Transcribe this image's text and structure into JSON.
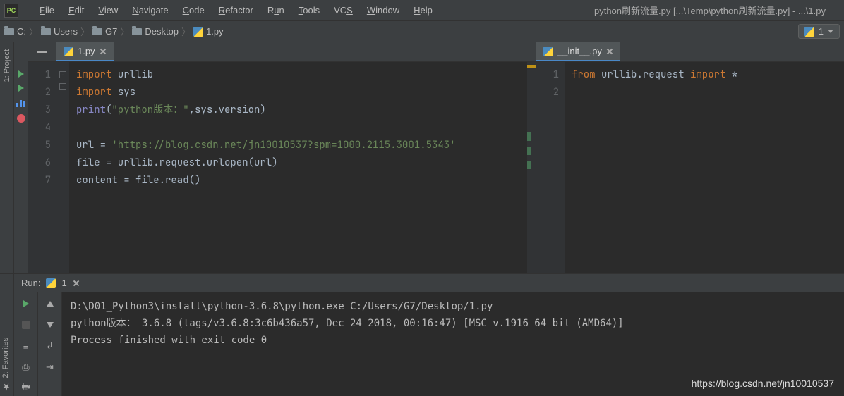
{
  "menubar": {
    "items": [
      "File",
      "Edit",
      "View",
      "Navigate",
      "Code",
      "Refactor",
      "Run",
      "Tools",
      "VCS",
      "Window",
      "Help"
    ],
    "window_title": "python刷新流量.py [...\\Temp\\python刷新流量.py] - ...\\1.py"
  },
  "breadcrumb": {
    "drive": "C:",
    "parts": [
      "Users",
      "G7",
      "Desktop"
    ],
    "file": "1.py"
  },
  "run_config": {
    "label": "1"
  },
  "sidebar": {
    "project_label": "1: Project",
    "favorites_label": "2: Favorites"
  },
  "tabs": {
    "left": {
      "label": "1.py"
    },
    "right": {
      "label": "__init__.py"
    }
  },
  "editor_left": {
    "line_numbers": [
      "1",
      "2",
      "3",
      "4",
      "5",
      "6",
      "7"
    ],
    "lines": [
      {
        "t": "import",
        "i": "urllib"
      },
      {
        "t": "import",
        "i": "sys"
      },
      {
        "t": "print_version",
        "pre": "print(",
        "str": "\"python版本：\"",
        "mid": ",",
        "expr": "sys.version",
        "post": ")"
      },
      {
        "t": "blank"
      },
      {
        "t": "assign_url",
        "lhs": "url = ",
        "str": "'https://blog.csdn.net/jn10010537?spm=1000.2115.3001.5343'"
      },
      {
        "t": "plain",
        "txt": "file = urllib.request.urlopen(url)"
      },
      {
        "t": "plain",
        "txt": "content = file.read()"
      }
    ]
  },
  "editor_right": {
    "line_numbers": [
      "1",
      "2"
    ],
    "line1": {
      "kw1": "from ",
      "mod": "urllib.request ",
      "kw2": "import ",
      "star": "*"
    }
  },
  "run_panel": {
    "label": "Run:",
    "config": "1",
    "lines": [
      "D:\\D01_Python3\\install\\python-3.6.8\\python.exe C:/Users/G7/Desktop/1.py",
      "python版本： 3.6.8 (tags/v3.6.8:3c6b436a57, Dec 24 2018, 00:16:47) [MSC v.1916 64 bit (AMD64)]",
      "",
      "Process finished with exit code 0"
    ]
  },
  "watermark": "https://blog.csdn.net/jn10010537"
}
